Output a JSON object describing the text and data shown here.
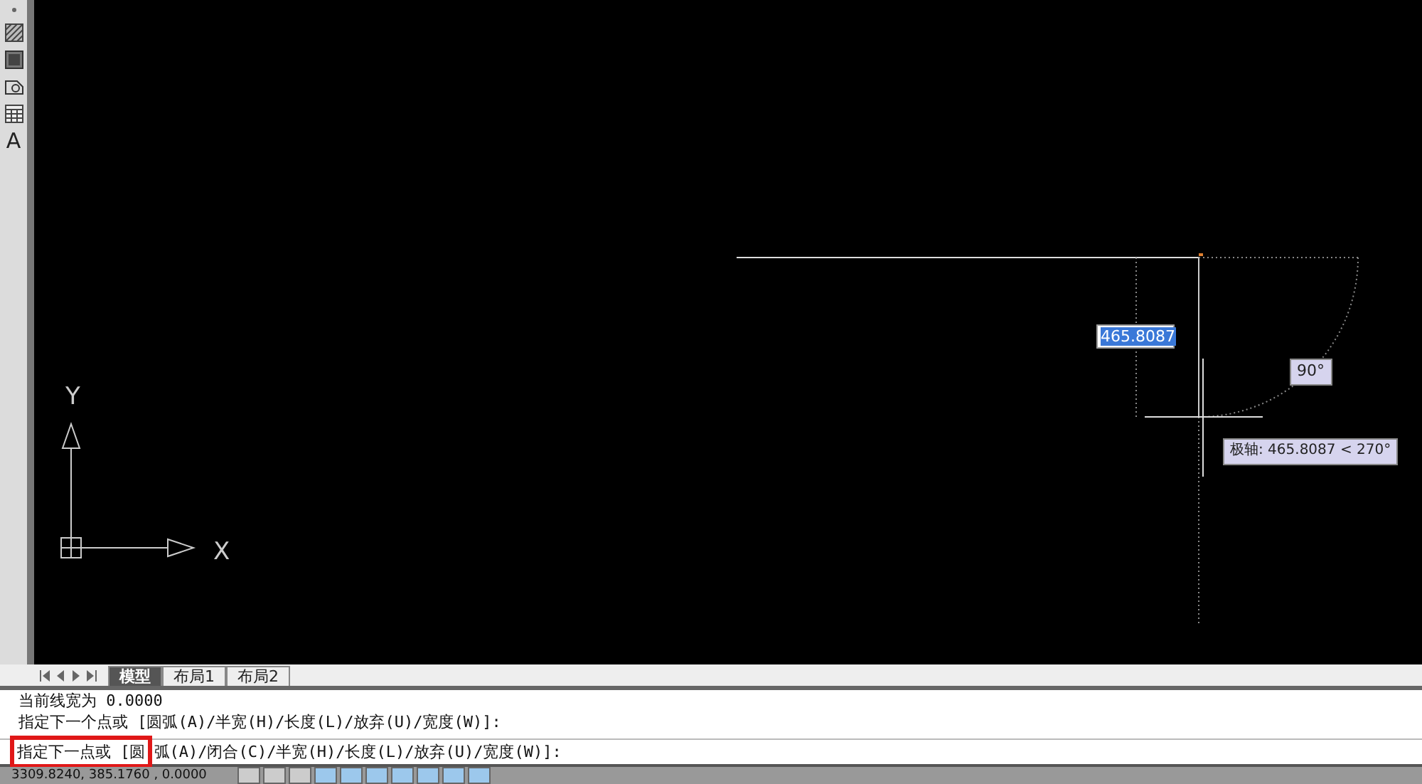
{
  "toolbar": [
    {
      "kind": "dot"
    },
    {
      "kind": "hatch"
    },
    {
      "kind": "gradient"
    },
    {
      "kind": "region"
    },
    {
      "kind": "table"
    },
    {
      "kind": "text",
      "label": "A"
    }
  ],
  "canvas": {
    "ucs": {
      "y_label": "Y",
      "x_label": "X"
    },
    "length_input": "465.8087",
    "angle_label": "90°",
    "polar_tooltip": "极轴: 465.8087 < 270°"
  },
  "layout_tabs": [
    {
      "label": "模型",
      "selected": true
    },
    {
      "label": "布局1",
      "selected": false
    },
    {
      "label": "布局2",
      "selected": false
    }
  ],
  "command_history": [
    "当前线宽为 0.0000",
    "指定下一个点或 [圆弧(A)/半宽(H)/长度(L)/放弃(U)/宽度(W)]:"
  ],
  "command_line": {
    "highlighted": "指定下一点或 [圆",
    "rest": "弧(A)/闭合(C)/半宽(H)/长度(L)/放弃(U)/宽度(W)]:"
  },
  "status_bar": {
    "coordinates": "3309.8240, 385.1760 , 0.0000",
    "toggles": [
      {
        "on": false
      },
      {
        "on": false
      },
      {
        "on": false
      },
      {
        "on": true
      },
      {
        "on": true
      },
      {
        "on": true
      },
      {
        "on": true
      },
      {
        "on": true
      },
      {
        "on": true
      },
      {
        "on": true
      }
    ]
  }
}
